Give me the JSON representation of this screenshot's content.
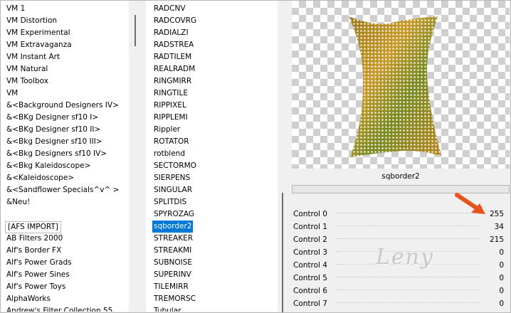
{
  "categories": [
    "VM 1",
    "VM Distortion",
    "VM Experimental",
    "VM Extravaganza",
    "VM Instant Art",
    "VM Natural",
    "VM Toolbox",
    "VM",
    "&<Background Designers IV>",
    "&<BKg Designer sf10 I>",
    "&<BKg Designer sf10 II>",
    "&<Bkg Designer sf10 III>",
    "&<Bkg Designers sf10 IV>",
    "&<Bkg Kaleidoscope>",
    "&<Kaleidoscope>",
    "&<Sandflower Specials^v^ >",
    "&Neu!",
    "",
    "[AFS IMPORT]",
    "AB Filters 2000",
    "Alf's Border FX",
    "Alf's Power Grads",
    "Alf's Power Sines",
    "Alf's Power Toys",
    "AlphaWorks",
    "Andrew's Filter Collection 55"
  ],
  "selected_category": "[AFS IMPORT]",
  "filters": [
    "RADCNV",
    "RADCOVRG",
    "RADIALZI",
    "RADSTREA",
    "RADTILEM",
    "REALRADM",
    "RINGMIRR",
    "RINGTILE",
    "RIPPIXEL",
    "RIPPLEMI",
    "Rippler",
    "ROTATOR",
    "rotblend",
    "SECTORMO",
    "SIERPENS",
    "SINGULAR",
    "SPLITDIS",
    "SPYROZAG",
    "sqborder2",
    "STREAKER",
    "STREAKMI",
    "SUBNOISE",
    "SUPERINV",
    "TILEMIRR",
    "TREMORSC",
    "Tubular"
  ],
  "selected_filter": "sqborder2",
  "preview_caption": "sqborder2",
  "controls": [
    {
      "label": "Control 0",
      "value": "255"
    },
    {
      "label": "Control 1",
      "value": "34"
    },
    {
      "label": "Control 2",
      "value": "215"
    },
    {
      "label": "Control 3",
      "value": "0"
    },
    {
      "label": "Control 4",
      "value": "0"
    },
    {
      "label": "Control 5",
      "value": "0"
    },
    {
      "label": "Control 6",
      "value": "0"
    },
    {
      "label": "Control 7",
      "value": "0"
    }
  ],
  "watermark": "Leny",
  "colors": {
    "selection": "#0078d7",
    "arrow": "#e8521c"
  }
}
